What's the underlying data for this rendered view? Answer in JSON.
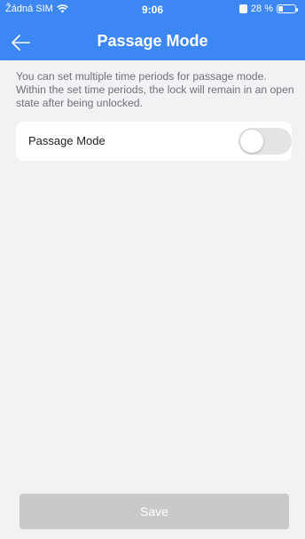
{
  "status_bar": {
    "carrier": "Žádná SIM",
    "time": "9:06",
    "battery": "28 %",
    "battery_level": 0.28
  },
  "header": {
    "title": "Passage Mode",
    "back_icon": "arrow-left-icon"
  },
  "description": "You can set multiple time periods for passage mode. Within the set time periods, the lock will remain in an open state after being unlocked.",
  "passage_mode": {
    "label": "Passage Mode",
    "enabled": false
  },
  "save_button": {
    "label": "Save"
  },
  "colors": {
    "header": "#3d87f5",
    "background": "#f2f2f4",
    "save_disabled": "#c9c9cc"
  }
}
